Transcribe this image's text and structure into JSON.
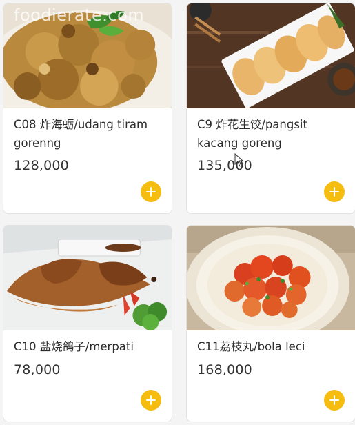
{
  "watermark": "foodierate.com",
  "accent_color": "#f5bd10",
  "add_icon": "plus-icon",
  "items": [
    {
      "name": "C08 炸海蛎/udang tiram gorenng",
      "price": "128,000"
    },
    {
      "name": "C9 炸花生饺/pangsit kacang goreng",
      "price": "135,000"
    },
    {
      "name": "C10 盐烧鸽子/merpati",
      "price": "78,000"
    },
    {
      "name": "C11荔枝丸/bola leci",
      "price": "168,000"
    }
  ]
}
